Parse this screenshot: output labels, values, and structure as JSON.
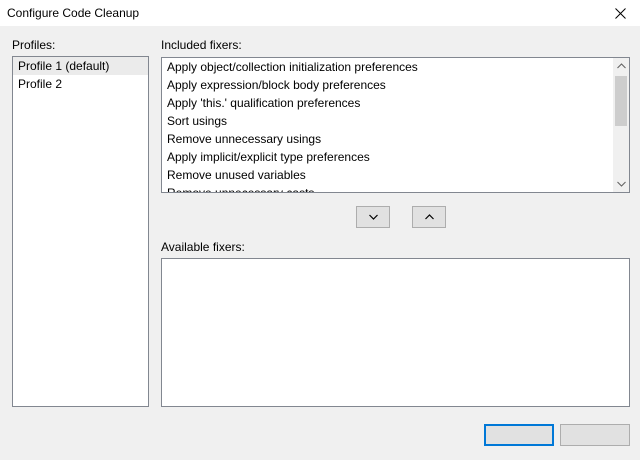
{
  "window": {
    "title": "Configure Code Cleanup"
  },
  "profiles": {
    "label": "Profiles:",
    "items": [
      {
        "label": "Profile 1 (default)",
        "selected": true
      },
      {
        "label": "Profile 2",
        "selected": false
      }
    ]
  },
  "included": {
    "label": "Included fixers:",
    "items": [
      "Apply object/collection initialization preferences",
      "Apply expression/block body preferences",
      "Apply 'this.' qualification preferences",
      "Sort usings",
      "Remove unnecessary usings",
      "Apply implicit/explicit type preferences",
      "Remove unused variables",
      "Remove unnecessary casts"
    ]
  },
  "available": {
    "label": "Available fixers:",
    "items": []
  },
  "footer": {
    "ok_label": "",
    "cancel_label": ""
  },
  "colors": {
    "accent": "#0078d7",
    "dialog_bg": "#f0f0f0",
    "selection": "#ebebeb",
    "border": "#828790"
  },
  "icons": {
    "close": "close-icon",
    "move_down": "chevron-down-icon",
    "move_up": "chevron-up-icon"
  }
}
